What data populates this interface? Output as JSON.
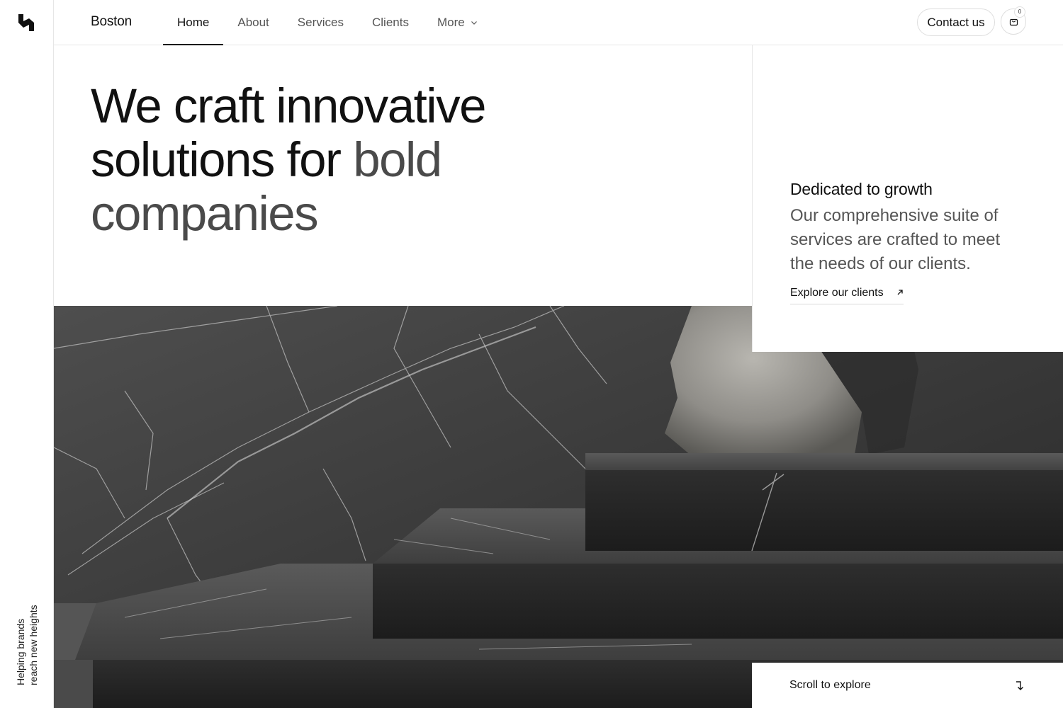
{
  "site": {
    "brand": "Boston",
    "tagline_line1": "Helping brands",
    "tagline_line2": "reach new heights"
  },
  "nav": {
    "items": [
      {
        "label": "Home",
        "active": true
      },
      {
        "label": "About",
        "active": false
      },
      {
        "label": "Services",
        "active": false
      },
      {
        "label": "Clients",
        "active": false
      },
      {
        "label": "More",
        "active": false,
        "icon": "chevron-down-icon"
      }
    ],
    "contact_label": "Contact us",
    "cart_count": "0",
    "cart_icon": "shopping-bag-icon"
  },
  "hero": {
    "headline_strong": "We craft innovative solutions for ",
    "headline_muted": "bold companies",
    "image_desc_icon": "hero-image"
  },
  "info": {
    "title": "Dedicated to growth",
    "body": "Our comprehensive suite of services are crafted to meet the needs of our clients.",
    "link_label": "Explore our clients",
    "link_icon": "arrow-up-right-icon"
  },
  "scroll": {
    "label": "Scroll to explore",
    "icon": "arrow-down-right-icon"
  },
  "colors": {
    "text": "#111111",
    "muted": "#4a4a4a",
    "border": "#e6e6e6",
    "background": "#ffffff"
  }
}
